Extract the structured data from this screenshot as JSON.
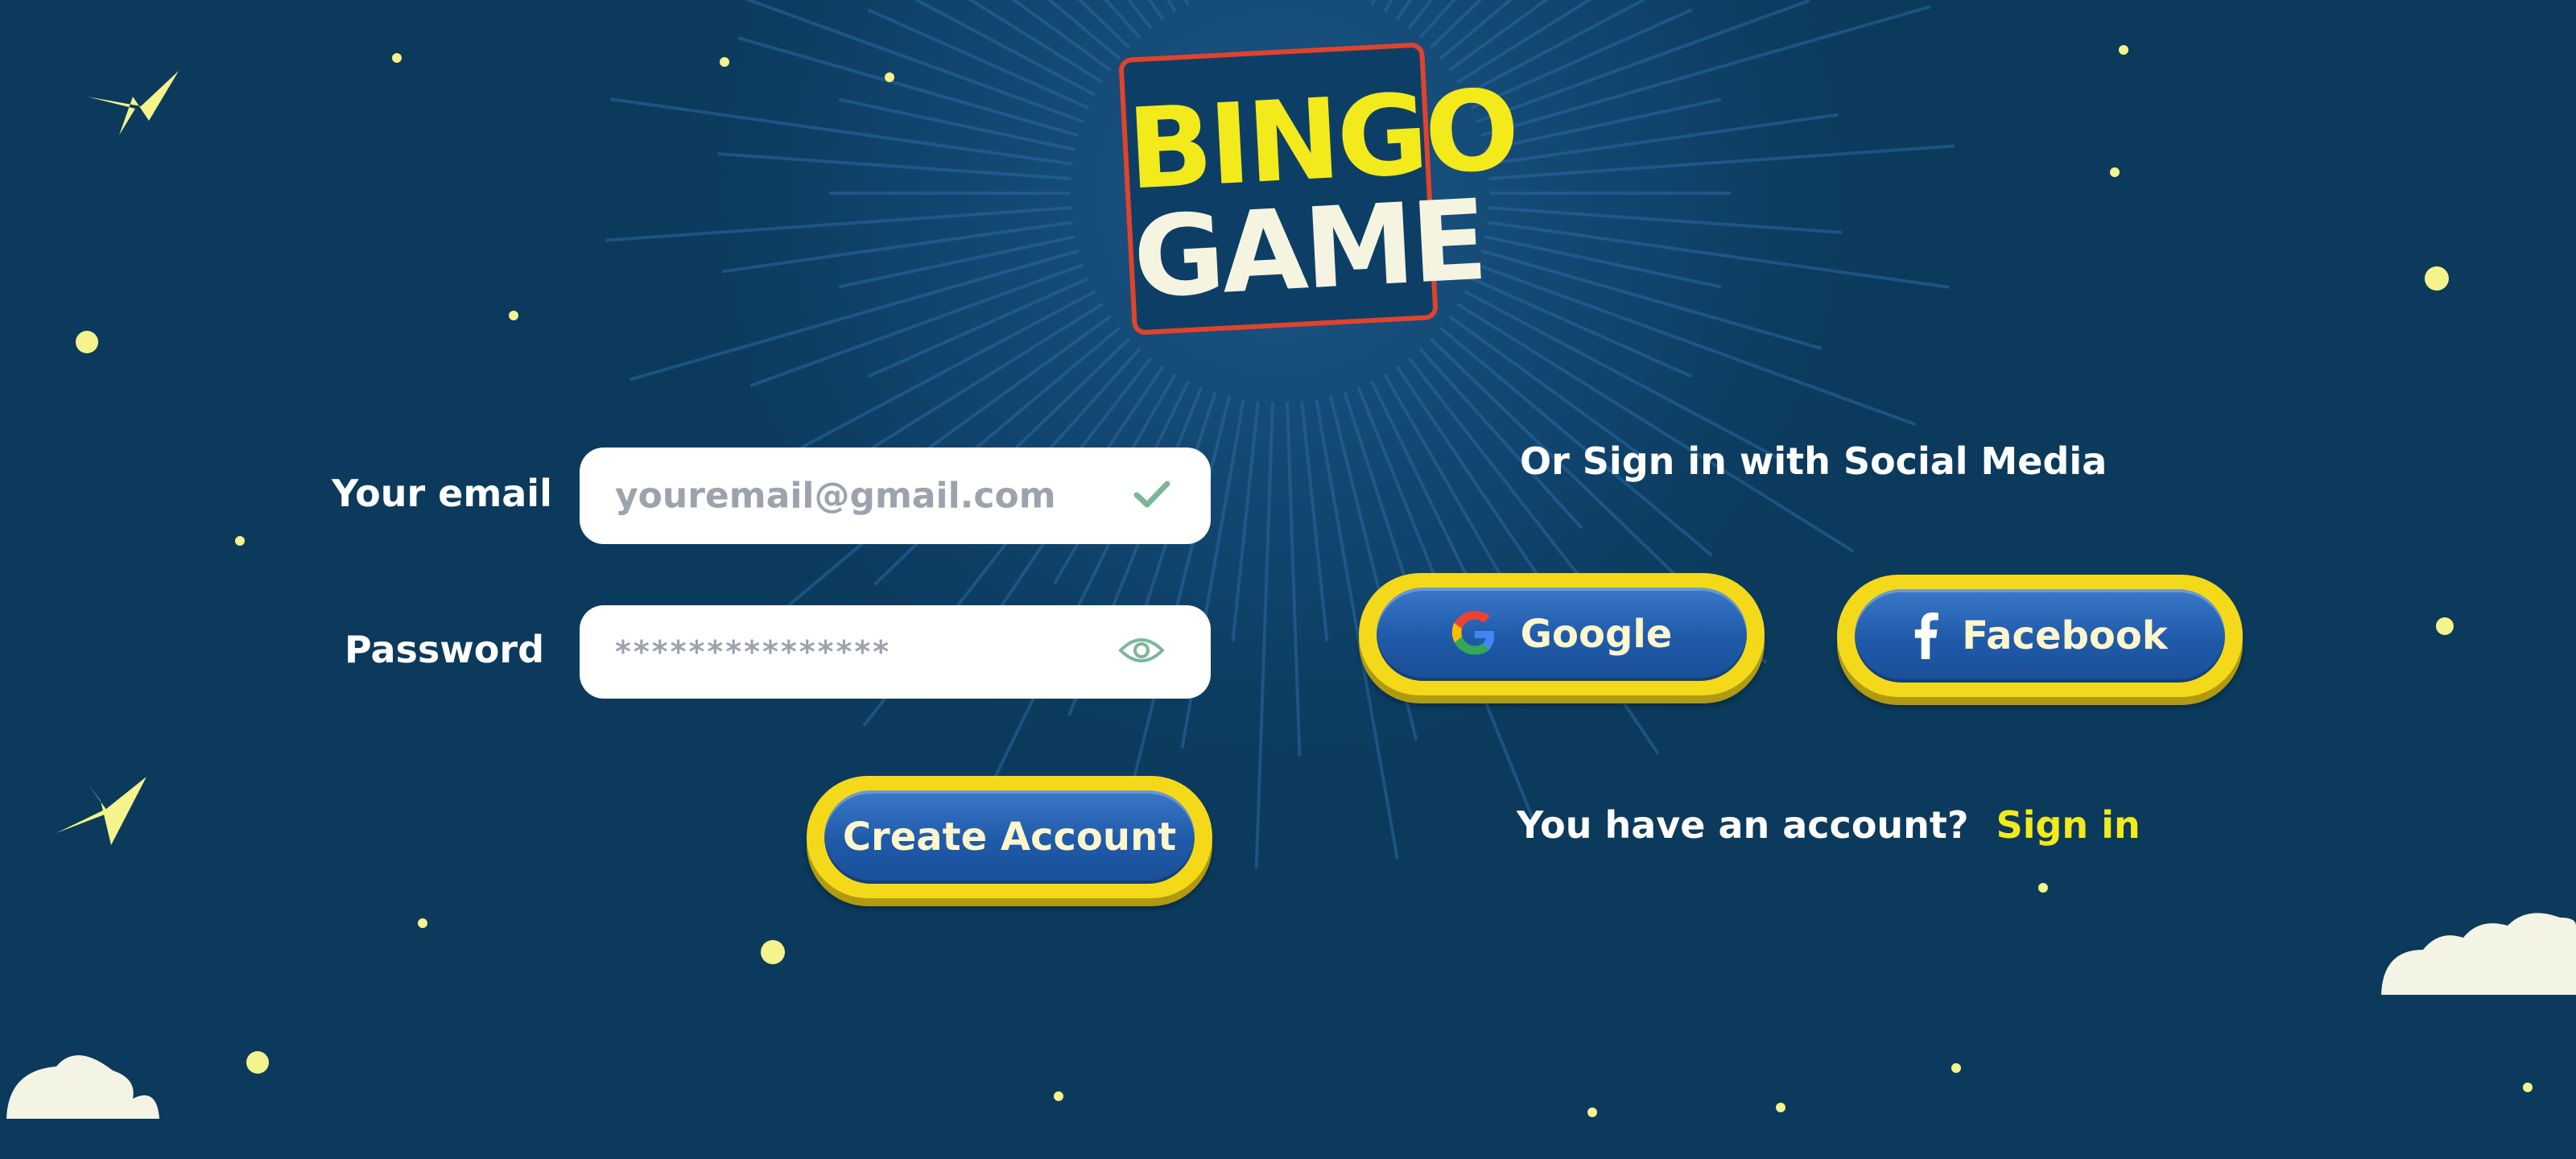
{
  "logo": {
    "line1": "BINGO",
    "line2": "GAME"
  },
  "form": {
    "email_label": "Your email",
    "email_value": "youremail@gmail.com",
    "password_label": "Password",
    "password_value": "***************",
    "create_label": "Create Account"
  },
  "social": {
    "heading": "Or Sign in with Social Media",
    "google_label": "Google",
    "facebook_label": "Facebook",
    "account_prompt": "You have an account?",
    "signin_label": "Sign in"
  },
  "icons": {
    "email_status": "check-icon",
    "password_toggle": "eye-icon",
    "google": "google-icon",
    "facebook": "facebook-icon"
  },
  "colors": {
    "background": "#0b3a5c",
    "accent_yellow": "#f3ea1c",
    "button_blue": "#1f5aa9",
    "logo_border": "#e0432b"
  }
}
